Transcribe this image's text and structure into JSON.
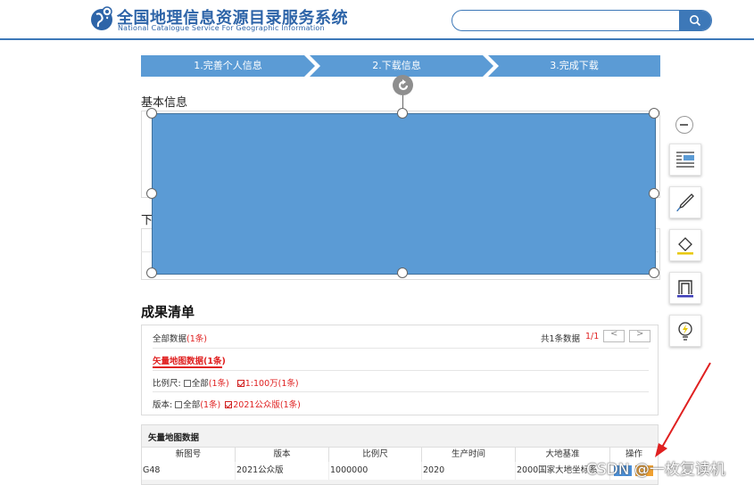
{
  "header": {
    "title_cn": "全国地理信息资源目录服务系统",
    "title_en": "National Catalogue Service For Geographic Information",
    "search": {
      "placeholder": "",
      "value": ""
    },
    "search_icon": "search-icon"
  },
  "steps": [
    {
      "label": "1.完善个人信息"
    },
    {
      "label": "2.下载信息"
    },
    {
      "label": "3.完成下载"
    }
  ],
  "sections": {
    "basic_info": "基本信息",
    "download_partial": "下"
  },
  "toolbar": {
    "icons": [
      "collapse-icon",
      "text-wrap-icon",
      "pen-icon",
      "fill-color-icon",
      "outline-icon",
      "idea-bulb-icon"
    ],
    "fill_color": "#5b9bd5",
    "accent": "#3d78b8"
  },
  "results": {
    "title": "成果清单",
    "all_data_label": "全部数据",
    "all_data_count": "(1条)",
    "total_text": "共1条数据",
    "page_indicator": "1/1",
    "prev_label": "<",
    "next_label": ">",
    "vector_tab": "矢量地图数据(1条)",
    "scale_label": "比例尺:",
    "scale_all": "全部",
    "scale_all_count": "(1条)",
    "scale_option": "1:100万(1条)",
    "version_label": "版本:",
    "version_all": "全部",
    "version_all_count": "(1条)",
    "version_option": "2021公众版(1条)"
  },
  "data_table": {
    "title": "矢量地图数据",
    "columns": [
      "新图号",
      "版本",
      "比例尺",
      "生产时间",
      "大地基准",
      "操作"
    ],
    "rows": [
      [
        "G48",
        "2021公众版",
        "1000000",
        "2020",
        "2000国家大地坐标系",
        ""
      ]
    ]
  },
  "watermark": "CSDN @一枚复读机"
}
